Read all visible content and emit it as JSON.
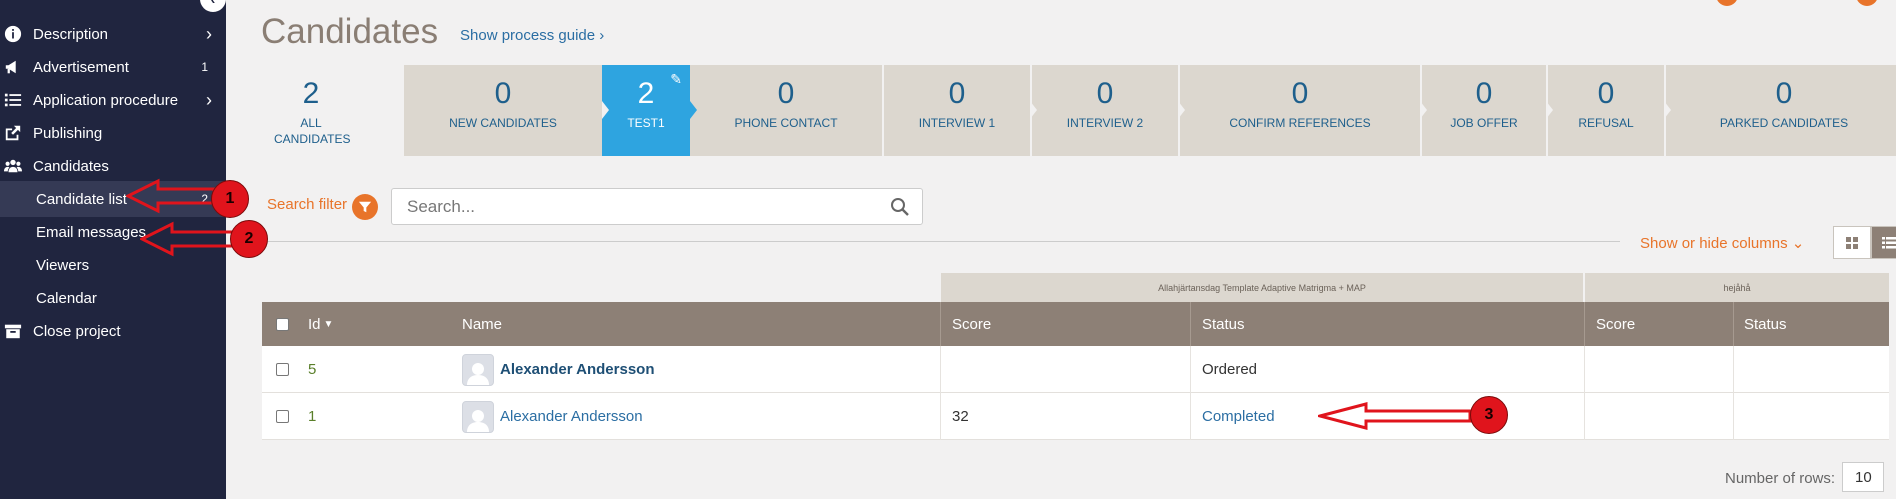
{
  "sidebar": {
    "items": [
      {
        "label": "Description",
        "icon": "info-icon",
        "chevron": "›"
      },
      {
        "label": "Advertisement",
        "icon": "megaphone-icon",
        "count": "1"
      },
      {
        "label": "Application procedure",
        "icon": "list-icon",
        "chevron": "›"
      },
      {
        "label": "Publishing",
        "icon": "share-icon"
      },
      {
        "label": "Candidates",
        "icon": "users-icon",
        "chevron": "⌄"
      }
    ],
    "subitems": [
      {
        "label": "Candidate list",
        "count": "2"
      },
      {
        "label": "Email messages"
      },
      {
        "label": "Viewers"
      },
      {
        "label": "Calendar"
      }
    ],
    "close": {
      "label": "Close project",
      "icon": "archive-icon"
    }
  },
  "header": {
    "title": "Candidates",
    "process_guide": "Show process guide ›"
  },
  "stages": [
    {
      "count": "2",
      "label": "ALL CANDIDATES"
    },
    {
      "count": "0",
      "label": "NEW CANDIDATES"
    },
    {
      "count": "2",
      "label": "TEST1"
    },
    {
      "count": "0",
      "label": "PHONE CONTACT"
    },
    {
      "count": "0",
      "label": "INTERVIEW 1"
    },
    {
      "count": "0",
      "label": "INTERVIEW 2"
    },
    {
      "count": "0",
      "label": "CONFIRM REFERENCES"
    },
    {
      "count": "0",
      "label": "JOB OFFER"
    },
    {
      "count": "0",
      "label": "REFUSAL"
    },
    {
      "count": "0",
      "label": "PARKED CANDIDATES"
    }
  ],
  "search": {
    "filter_label": "Search filter",
    "placeholder": "Search..."
  },
  "toolbar": {
    "show_columns": "Show or hide columns ⌄"
  },
  "table": {
    "group_headers": [
      "Allahjärtansdag Template Adaptive Matrigma + MAP",
      "hejåhå"
    ],
    "columns": [
      "Id",
      "Name",
      "Score",
      "Status",
      "Score",
      "Status"
    ],
    "rows": [
      {
        "id": "5",
        "name": "Alexander Andersson",
        "score1": "",
        "status1": "Ordered",
        "score2": "",
        "status2": ""
      },
      {
        "id": "1",
        "name": "Alexander Andersson",
        "score1": "32",
        "status1": "Completed",
        "score2": "",
        "status2": ""
      }
    ]
  },
  "pagination": {
    "rows_label": "Number of rows:",
    "rows_value": "10"
  },
  "annotations": [
    "1",
    "2",
    "3"
  ],
  "colors": {
    "sidebar_bg": "#20253f",
    "accent_orange": "#e8742a",
    "active_stage": "#2ea4e0",
    "table_header": "#8d8076",
    "link": "#2b6ea3",
    "annotation_red": "#e0141c"
  }
}
